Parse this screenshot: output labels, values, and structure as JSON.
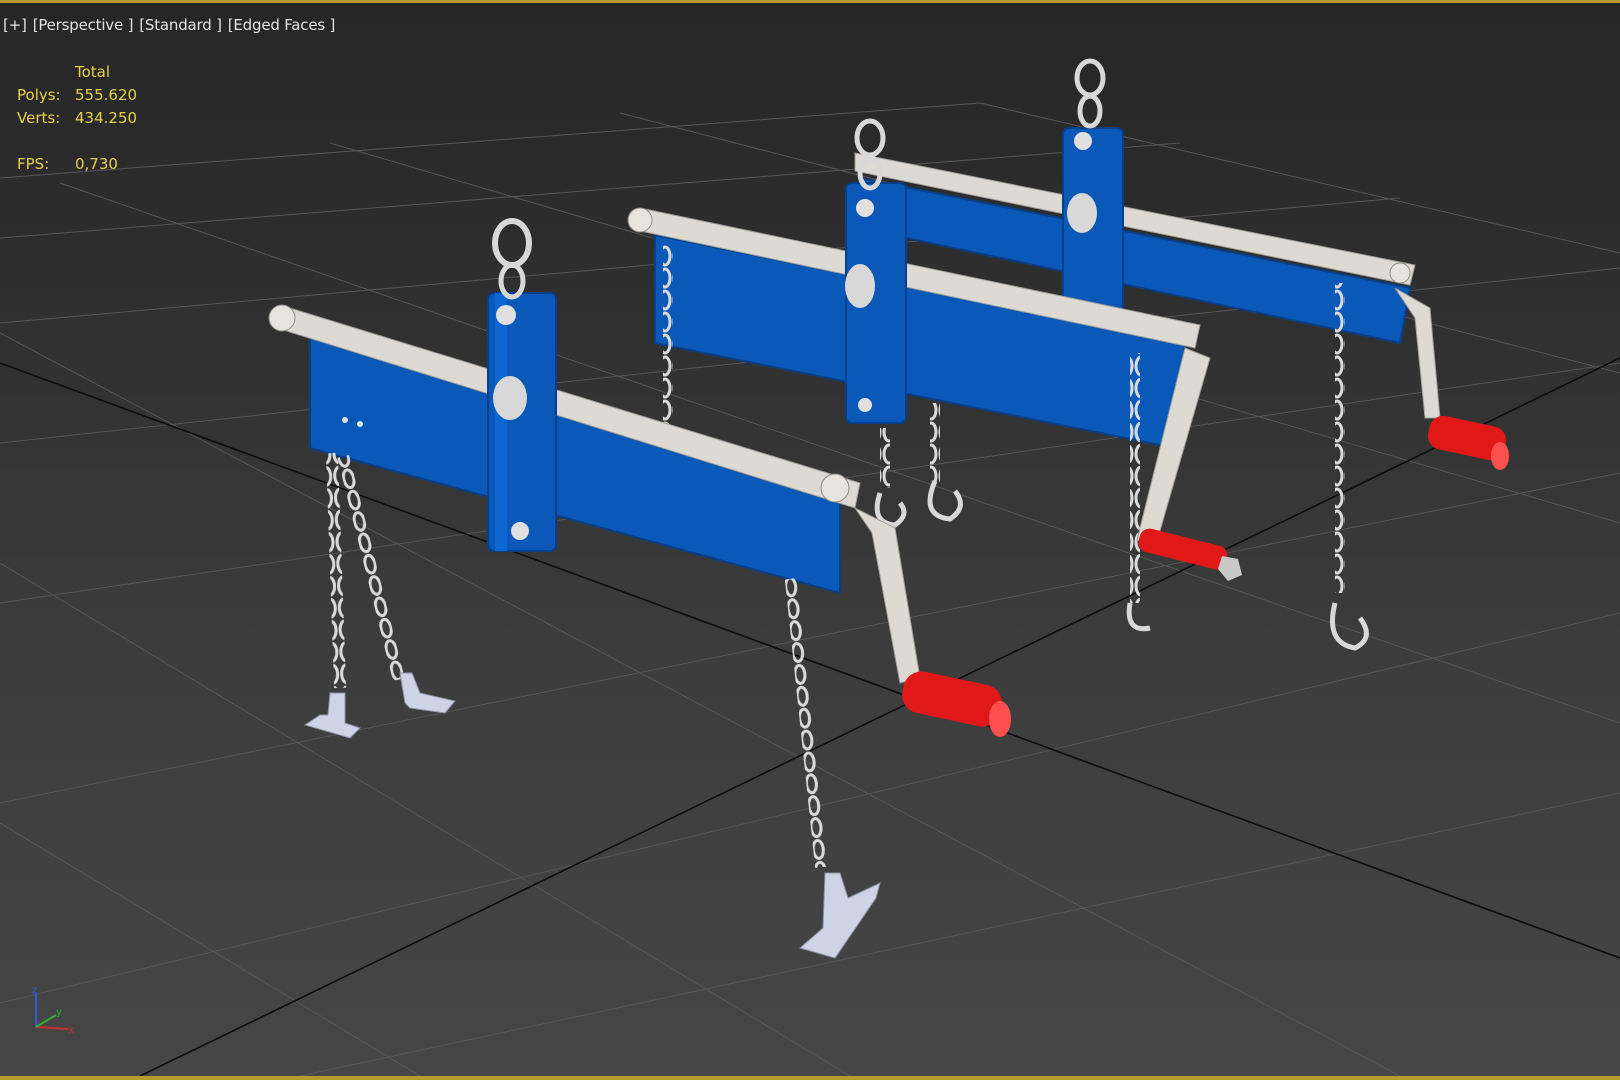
{
  "viewport": {
    "labels": [
      "[+]",
      "[Perspective ]",
      "[Standard ]",
      "[Edged Faces ]"
    ]
  },
  "stats": {
    "header": "Total",
    "polys_label": "Polys:",
    "polys_value": "555.620",
    "verts_label": "Verts:",
    "verts_value": "434.250",
    "fps_label": "FPS:",
    "fps_value": "0,730"
  },
  "scene": {
    "object": "engine-load-leveler",
    "count": 3,
    "colors": {
      "beam_blue": "#0a58b8",
      "beam_blue_dark": "#063f8a",
      "bar_white": "#dcdad2",
      "chain": "#d6d6d6",
      "handle_red": "#e01818",
      "grid_line": "#5a5a5a",
      "axis_line": "#101010",
      "frame": "#b59a2c"
    }
  },
  "gizmo": {
    "axes": [
      "z",
      "y",
      "x"
    ]
  }
}
